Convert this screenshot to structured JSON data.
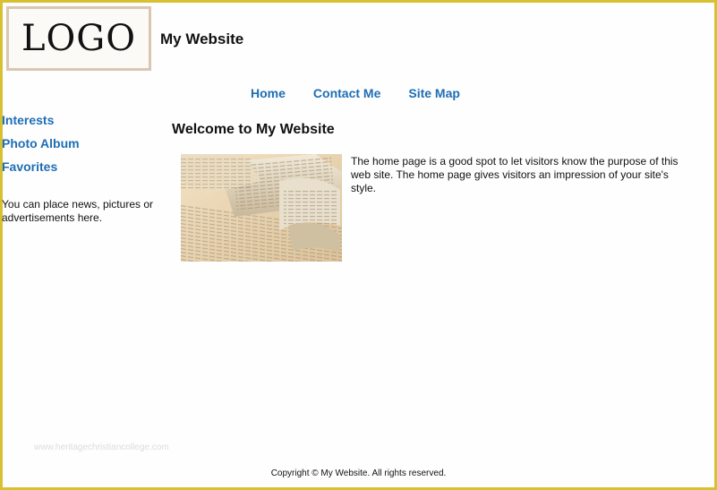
{
  "header": {
    "logo_text": "LOGO",
    "site_title": "My Website"
  },
  "top_nav": [
    {
      "label": "Home"
    },
    {
      "label": "Contact Me"
    },
    {
      "label": "Site Map"
    }
  ],
  "side_nav": [
    {
      "label": "Interests"
    },
    {
      "label": "Photo Album"
    },
    {
      "label": "Favorites"
    }
  ],
  "side_note": "You can place news, pictures or advertisements here.",
  "main": {
    "heading": "Welcome to My Website",
    "intro": "The home page is a good spot to let visitors know the purpose of this web site. The home page gives visitors an impression of your site's style."
  },
  "watermark": "www.heritagechristiancollege.com",
  "footer": "Copyright © My Website.  All rights reserved.",
  "colors": {
    "border": "#d8c131",
    "link": "#1e6eb5",
    "logo_border": "#d9c7b1"
  }
}
